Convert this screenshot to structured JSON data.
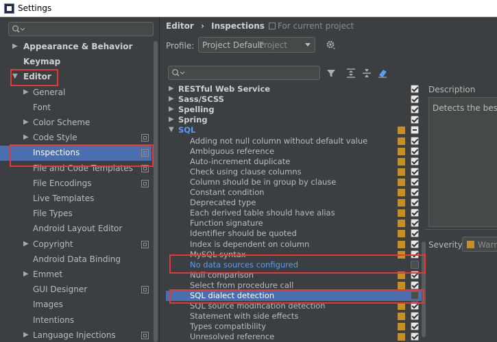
{
  "window": {
    "title": "Settings"
  },
  "left_tree": {
    "items": [
      {
        "label": "Appearance & Behavior",
        "arrow": "▶",
        "bold": true,
        "indent": 0,
        "proj": false,
        "selected": false
      },
      {
        "label": "Keymap",
        "arrow": "",
        "bold": true,
        "indent": 0,
        "proj": false,
        "selected": false
      },
      {
        "label": "Editor",
        "arrow": "▼",
        "bold": true,
        "indent": 0,
        "proj": false,
        "selected": false
      },
      {
        "label": "General",
        "arrow": "▶",
        "bold": false,
        "indent": 1,
        "proj": false,
        "selected": false
      },
      {
        "label": "Font",
        "arrow": "",
        "bold": false,
        "indent": 1,
        "proj": false,
        "selected": false
      },
      {
        "label": "Color Scheme",
        "arrow": "▶",
        "bold": false,
        "indent": 1,
        "proj": false,
        "selected": false
      },
      {
        "label": "Code Style",
        "arrow": "▶",
        "bold": false,
        "indent": 1,
        "proj": true,
        "selected": false
      },
      {
        "label": "Inspections",
        "arrow": "",
        "bold": false,
        "indent": 1,
        "proj": true,
        "selected": true
      },
      {
        "label": "File and Code Templates",
        "arrow": "",
        "bold": false,
        "indent": 1,
        "proj": true,
        "selected": false
      },
      {
        "label": "File Encodings",
        "arrow": "",
        "bold": false,
        "indent": 1,
        "proj": true,
        "selected": false
      },
      {
        "label": "Live Templates",
        "arrow": "",
        "bold": false,
        "indent": 1,
        "proj": false,
        "selected": false
      },
      {
        "label": "File Types",
        "arrow": "",
        "bold": false,
        "indent": 1,
        "proj": false,
        "selected": false
      },
      {
        "label": "Android Layout Editor",
        "arrow": "",
        "bold": false,
        "indent": 1,
        "proj": false,
        "selected": false
      },
      {
        "label": "Copyright",
        "arrow": "▶",
        "bold": false,
        "indent": 1,
        "proj": true,
        "selected": false
      },
      {
        "label": "Android Data Binding",
        "arrow": "",
        "bold": false,
        "indent": 1,
        "proj": false,
        "selected": false
      },
      {
        "label": "Emmet",
        "arrow": "▶",
        "bold": false,
        "indent": 1,
        "proj": false,
        "selected": false
      },
      {
        "label": "GUI Designer",
        "arrow": "",
        "bold": false,
        "indent": 1,
        "proj": true,
        "selected": false
      },
      {
        "label": "Images",
        "arrow": "",
        "bold": false,
        "indent": 1,
        "proj": false,
        "selected": false
      },
      {
        "label": "Intentions",
        "arrow": "",
        "bold": false,
        "indent": 1,
        "proj": false,
        "selected": false
      },
      {
        "label": "Language Injections",
        "arrow": "▶",
        "bold": false,
        "indent": 1,
        "proj": true,
        "selected": false
      }
    ]
  },
  "breadcrumb": {
    "part1": "Editor",
    "sep": "›",
    "part2": "Inspections"
  },
  "for_current_project": "For current project",
  "profile": {
    "label": "Profile:",
    "value": "Project Default",
    "scope": "Project"
  },
  "inspections": [
    {
      "label": "RESTful Web Service",
      "arrow": "▶",
      "kind": "group",
      "sev": false,
      "check": "checked",
      "selected": false
    },
    {
      "label": "Sass/SCSS",
      "arrow": "▶",
      "kind": "group",
      "sev": false,
      "check": "checked",
      "selected": false
    },
    {
      "label": "Spelling",
      "arrow": "▶",
      "kind": "group",
      "sev": false,
      "check": "checked",
      "selected": false
    },
    {
      "label": "Spring",
      "arrow": "▶",
      "kind": "group",
      "sev": false,
      "check": "checked",
      "selected": false
    },
    {
      "label": "SQL",
      "arrow": "▼",
      "kind": "sql",
      "sev": true,
      "check": "partial",
      "selected": false
    },
    {
      "label": "Adding not null column without default value",
      "arrow": "",
      "kind": "item",
      "sev": true,
      "check": "checked",
      "selected": false
    },
    {
      "label": "Ambiguous reference",
      "arrow": "",
      "kind": "item",
      "sev": true,
      "check": "checked",
      "selected": false
    },
    {
      "label": "Auto-increment duplicate",
      "arrow": "",
      "kind": "item",
      "sev": true,
      "check": "checked",
      "selected": false
    },
    {
      "label": "Check using clause columns",
      "arrow": "",
      "kind": "item",
      "sev": true,
      "check": "checked",
      "selected": false
    },
    {
      "label": "Column should be in group by clause",
      "arrow": "",
      "kind": "item",
      "sev": true,
      "check": "checked",
      "selected": false
    },
    {
      "label": "Constant condition",
      "arrow": "",
      "kind": "item",
      "sev": true,
      "check": "checked",
      "selected": false
    },
    {
      "label": "Deprecated type",
      "arrow": "",
      "kind": "item",
      "sev": true,
      "check": "checked",
      "selected": false
    },
    {
      "label": "Each derived table should have alias",
      "arrow": "",
      "kind": "item",
      "sev": true,
      "check": "checked",
      "selected": false
    },
    {
      "label": "Function signature",
      "arrow": "",
      "kind": "item",
      "sev": true,
      "check": "checked",
      "selected": false
    },
    {
      "label": "Identifier should be quoted",
      "arrow": "",
      "kind": "item",
      "sev": true,
      "check": "checked",
      "selected": false
    },
    {
      "label": "Index is dependent on column",
      "arrow": "",
      "kind": "item",
      "sev": true,
      "check": "checked",
      "selected": false
    },
    {
      "label": "MySQL syntax",
      "arrow": "",
      "kind": "item",
      "sev": true,
      "check": "checked",
      "selected": false
    },
    {
      "label": "No data sources configured",
      "arrow": "",
      "kind": "link",
      "sev": false,
      "check": "unchecked",
      "selected": false
    },
    {
      "label": "Null comparison",
      "arrow": "",
      "kind": "item",
      "sev": true,
      "check": "checked",
      "selected": false
    },
    {
      "label": "Select from procedure call",
      "arrow": "",
      "kind": "item",
      "sev": true,
      "check": "checked",
      "selected": false
    },
    {
      "label": "SQL dialect detection",
      "arrow": "",
      "kind": "item",
      "sev": false,
      "check": "unchecked",
      "selected": true
    },
    {
      "label": "SQL source modification detection",
      "arrow": "",
      "kind": "item",
      "sev": true,
      "check": "checked",
      "selected": false
    },
    {
      "label": "Statement with side effects",
      "arrow": "",
      "kind": "item",
      "sev": true,
      "check": "checked",
      "selected": false
    },
    {
      "label": "Types compatibility",
      "arrow": "",
      "kind": "item",
      "sev": true,
      "check": "checked",
      "selected": false
    },
    {
      "label": "Unresolved reference",
      "arrow": "",
      "kind": "item",
      "sev": true,
      "check": "checked",
      "selected": false
    }
  ],
  "description": {
    "label": "Description",
    "text": "Detects the best m"
  },
  "severity": {
    "label": "Severity:",
    "value": "Warni"
  },
  "colors": {
    "selection": "#4b6eaf",
    "severity_warning": "#c58f27",
    "link": "#589df6",
    "highlight_box": "#e53935"
  }
}
